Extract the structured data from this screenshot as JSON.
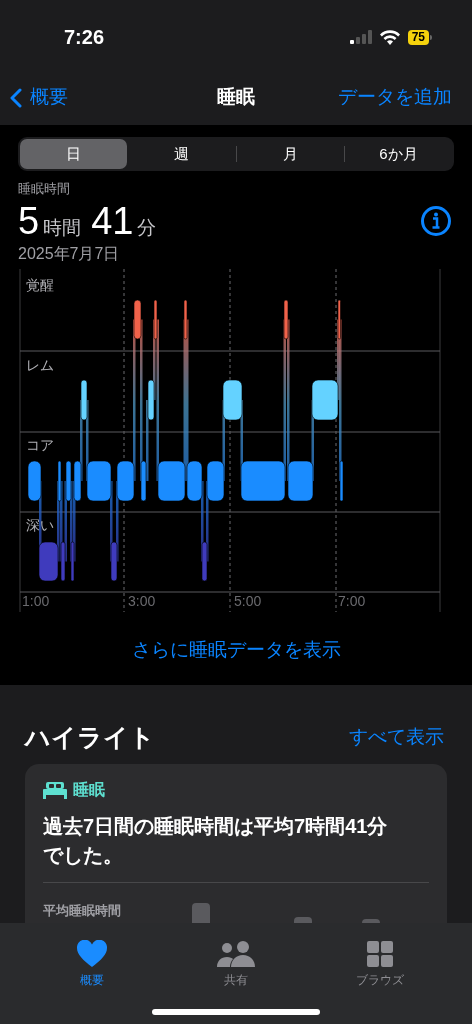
{
  "status_bar": {
    "time": "7:26",
    "battery": "75"
  },
  "nav": {
    "back": "概要",
    "title": "睡眠",
    "action": "データを追加"
  },
  "segments": [
    {
      "label": "日",
      "selected": true
    },
    {
      "label": "週",
      "selected": false
    },
    {
      "label": "月",
      "selected": false
    },
    {
      "label": "6か月",
      "selected": false
    }
  ],
  "summary": {
    "label": "睡眠時間",
    "hours": "5",
    "hours_unit": "時間",
    "minutes": "41",
    "minutes_unit": "分",
    "date": "2025年7月7日"
  },
  "chart": {
    "stages": [
      "覚醒",
      "レム",
      "コア",
      "深い"
    ],
    "times": [
      "1:00",
      "3:00",
      "5:00",
      "7:00"
    ]
  },
  "more_link": "さらに睡眠データを表示",
  "highlights": {
    "title": "ハイライト",
    "show_all": "すべて表示",
    "card": {
      "category": "睡眠",
      "text": "過去7日間の睡眠時間は平均7時間41分でした。",
      "chart_label": "平均睡眠時間"
    }
  },
  "tab_bar": [
    {
      "label": "概要",
      "selected": true
    },
    {
      "label": "共有",
      "selected": false
    },
    {
      "label": "ブラウズ",
      "selected": false
    }
  ]
}
